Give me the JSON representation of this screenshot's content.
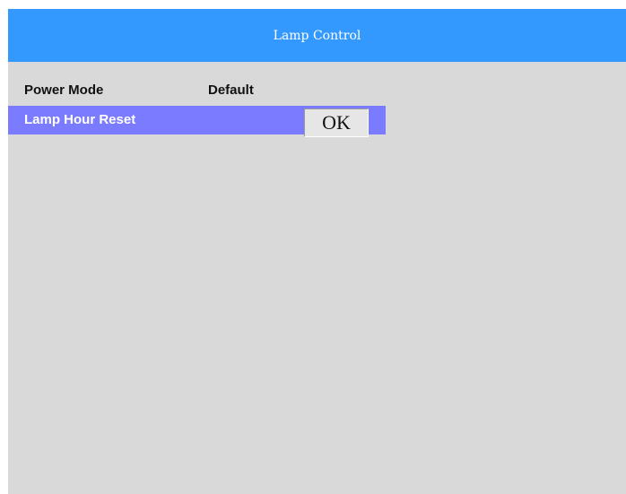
{
  "header": {
    "title": "Lamp Control"
  },
  "menu": {
    "items": [
      {
        "label": "Power Mode",
        "value": "Default"
      },
      {
        "label": "Lamp Hour Reset",
        "button_label": "OK"
      }
    ]
  },
  "colors": {
    "header_bg": "#3399ff",
    "panel_bg": "#d9d9d9",
    "selected_row_bg": "#7b7bff"
  }
}
